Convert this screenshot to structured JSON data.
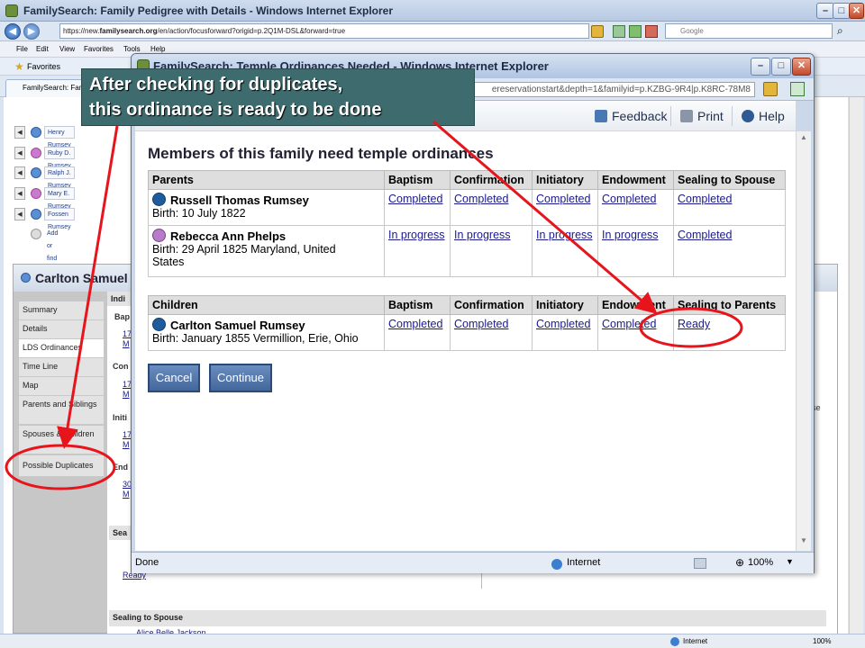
{
  "back_window": {
    "title": "FamilySearch: Family Pedigree with Details - Windows Internet Explorer",
    "url_prefix": "https://new.",
    "url_domain": "familysearch.org",
    "url_rest": "/en/action/focusforward?origid=p.2Q1M-DSL&forward=true",
    "search_placeholder": "Google",
    "menu": [
      "File",
      "Edit",
      "View",
      "Favorites",
      "Tools",
      "Help"
    ],
    "favorites_label": "Favorites",
    "tab_label": "FamilySearch: Fam",
    "pedigree": [
      "Henry Rumsey",
      "Ruby D. Rumsey",
      "Ralph J. Rumsey",
      "Mary E. Rumsey",
      "Fossen Rumsey",
      "Add or find child"
    ],
    "person_header": "Carlton Samuel",
    "nav": [
      "Summary",
      "Details",
      "LDS Ordinances",
      "Time Line",
      "Map",
      "Parents and Siblings",
      "Spouses & Children",
      "Possible Duplicates"
    ],
    "nav_selected": "LDS Ordinances",
    "strip_fragments": [
      "Indi",
      "Bap",
      "17",
      "M",
      "Con",
      "17",
      "M",
      "Initi",
      "17",
      "M",
      "End",
      "30",
      "M",
      "Sea",
      "Ready",
      "se"
    ],
    "sealing_section": "Sealing to Spouse",
    "sealing_name": "Alice Belle Jackson",
    "status_zone": "Internet",
    "status_zoom": "100%"
  },
  "popup": {
    "title": "FamilySearch: Temple Ordinances Needed - Windows Internet Explorer",
    "url_tail": "ereservationstart&depth=1&familyid=p.KZBG-9R4|p.K8RC-78M8",
    "toolbar": {
      "feedback": "Feedback",
      "print": "Print",
      "help": "Help"
    },
    "heading": "Members of this family need temple ordinances",
    "parents_table": {
      "headers": [
        "Parents",
        "Baptism",
        "Confirmation",
        "Initiatory",
        "Endowment",
        "Sealing to Spouse"
      ],
      "rows": [
        {
          "name": "Russell Thomas Rumsey",
          "gender": "male",
          "birth_line1": "Birth: 10 July 1822",
          "birth_line2": "",
          "status": [
            "Completed",
            "Completed",
            "Completed",
            "Completed",
            "Completed"
          ]
        },
        {
          "name": "Rebecca Ann Phelps",
          "gender": "female",
          "birth_line1": "Birth: 29 April 1825 Maryland, United",
          "birth_line2": "States",
          "status": [
            "In progress",
            "In progress",
            "In progress",
            "In progress",
            "Completed"
          ]
        }
      ]
    },
    "children_table": {
      "headers": [
        "Children",
        "Baptism",
        "Confirmation",
        "Initiatory",
        "Endowment",
        "Sealing to Parents"
      ],
      "rows": [
        {
          "name": "Carlton Samuel Rumsey",
          "gender": "male",
          "birth_line1": "Birth: January 1855 Vermillion, Erie, Ohio",
          "status": [
            "Completed",
            "Completed",
            "Completed",
            "Completed",
            "Ready"
          ]
        }
      ]
    },
    "buttons": {
      "cancel": "Cancel",
      "continue": "Continue"
    },
    "status": {
      "left": "Done",
      "zone": "Internet",
      "zoom": "100%"
    }
  },
  "callout": {
    "line1": "After checking for duplicates,",
    "line2": "this ordinance is ready to be done"
  },
  "annotation_color": "#e8141c"
}
